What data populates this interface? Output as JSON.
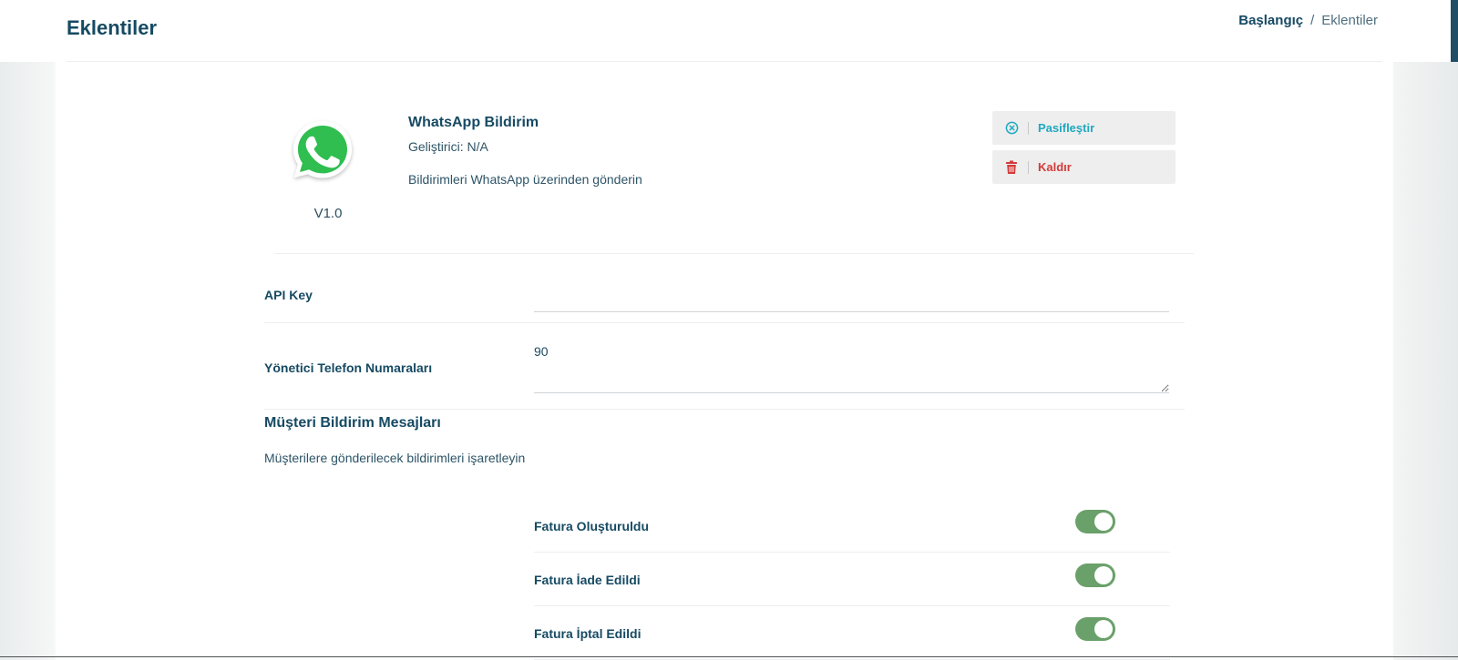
{
  "header": {
    "title": "Eklentiler",
    "breadcrumb": {
      "home": "Başlangıç",
      "separator": "/",
      "current": "Eklentiler"
    }
  },
  "plugin": {
    "name": "WhatsApp Bildirim",
    "developer": "Geliştirici: N/A",
    "description": "Bildirimleri WhatsApp üzerinden gönderin",
    "version": "V1.0",
    "logo_icon": "whatsapp-logo-icon",
    "actions": {
      "deactivate_label": "Pasifleştir",
      "deactivate_icon": "x-circle-icon",
      "remove_label": "Kaldır",
      "remove_icon": "trash-icon"
    }
  },
  "form": {
    "api_key": {
      "label": "API Key",
      "value": "",
      "placeholder": ""
    },
    "admin_phones": {
      "label": "Yönetici Telefon Numaraları",
      "value": "90"
    }
  },
  "customer_notifications": {
    "title": "Müşteri Bildirim Mesajları",
    "description": "Müşterilere gönderilecek bildirimleri işaretleyin",
    "items": [
      {
        "label": "Fatura Oluşturuldu",
        "enabled": true
      },
      {
        "label": "Fatura İade Edildi",
        "enabled": true
      },
      {
        "label": "Fatura İptal Edildi",
        "enabled": true
      }
    ]
  },
  "colors": {
    "primary_text": "#164a63",
    "toggle_on": "#6aa06a",
    "deactivate": "#1fa9c0",
    "remove": "#d23b3b",
    "whatsapp_green": "#25d366"
  }
}
